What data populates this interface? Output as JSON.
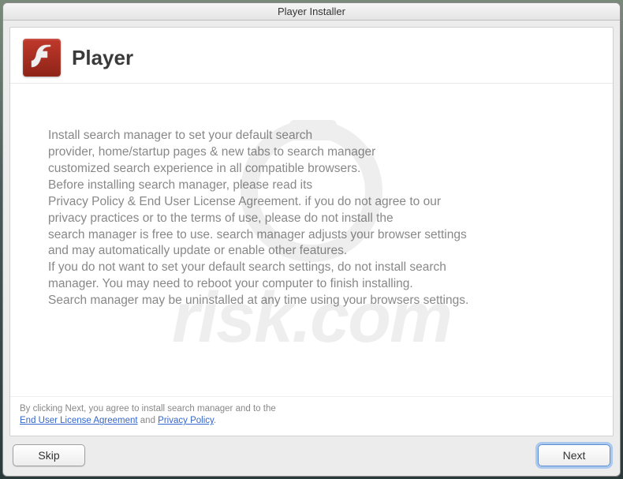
{
  "titlebar": {
    "title": "Player Installer"
  },
  "header": {
    "app_name": "Player",
    "icon_name": "flash-icon"
  },
  "body": {
    "text": "Install search manager to set your default search\nprovider, home/startup pages & new tabs to search manager\ncustomized search experience in all compatible browsers.\nBefore installing search manager, please read its\nPrivacy Policy & End User License Agreement. if you do not agree to our\nprivacy practices or to the terms of use, please do not install the\nsearch manager is free to use. search manager adjusts your browser settings\nand may automatically update or enable other features.\nIf you do not want to set your default search settings, do not install search\nmanager. You may need to reboot your computer to finish installing.\nSearch manager may be uninstalled at any time using your browsers settings."
  },
  "footer": {
    "prefix": "By clicking Next, you agree to install search manager and to the",
    "eula_label": "End User License Agreement",
    "and": " and ",
    "privacy_label": "Privacy Policy",
    "suffix": "."
  },
  "buttons": {
    "skip": "Skip",
    "next": "Next"
  },
  "watermark": {
    "text": "risk.com"
  }
}
